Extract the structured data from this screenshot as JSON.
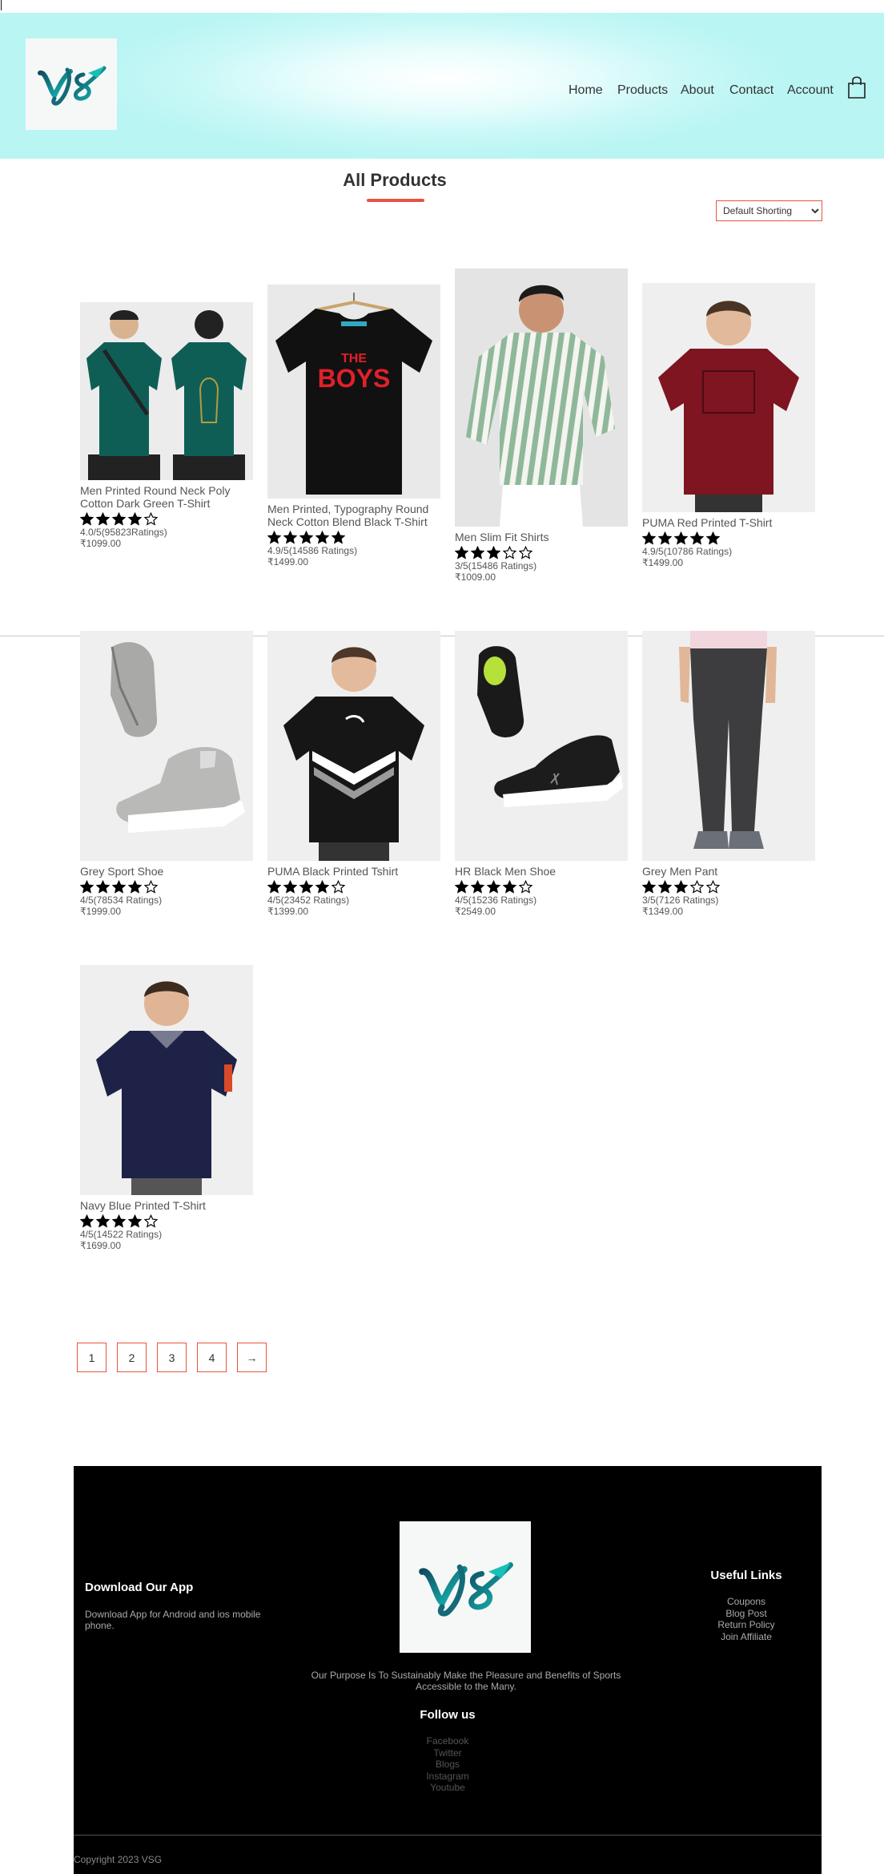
{
  "brand": {
    "logo_text": "VSG",
    "accent_color": "#e8543f",
    "header_color": "#b8f5f3"
  },
  "nav": {
    "items": [
      "Home",
      "Products",
      "About",
      "Contact",
      "Account"
    ],
    "cart_icon": "shopping-bag-icon"
  },
  "page": {
    "title": "All Products",
    "sort": {
      "selected": "Default Shorting"
    }
  },
  "products": [
    {
      "name": "Men Printed Round Neck Poly Cotton Dark Green T-Shirt",
      "stars": 4,
      "rating": "4.0/5(95823Ratings)",
      "price": "₹1099.00"
    },
    {
      "name": "Men Printed, Typography Round Neck Cotton Blend Black T-Shirt",
      "stars": 5,
      "rating": "4.9/5(14586 Ratings)",
      "price": "₹1499.00"
    },
    {
      "name": "Men Slim Fit Shirts",
      "stars": 3,
      "rating": "3/5(15486 Ratings)",
      "price": "₹1009.00"
    },
    {
      "name": "PUMA Red Printed T-Shirt",
      "stars": 5,
      "rating": "4.9/5(10786 Ratings)",
      "price": "₹1499.00"
    },
    {
      "name": "Grey Sport Shoe",
      "stars": 4,
      "rating": "4/5(78534 Ratings)",
      "price": "₹1999.00"
    },
    {
      "name": "PUMA Black Printed Tshirt",
      "stars": 4,
      "rating": "4/5(23452 Ratings)",
      "price": "₹1399.00"
    },
    {
      "name": "HR Black Men Shoe",
      "stars": 4,
      "rating": "4/5(15236 Ratings)",
      "price": "₹2549.00"
    },
    {
      "name": "Grey Men Pant",
      "stars": 3,
      "rating": "3/5(7126 Ratings)",
      "price": "₹1349.00"
    },
    {
      "name": "Navy Blue Printed T-Shirt",
      "stars": 4,
      "rating": "4/5(14522 Ratings)",
      "price": "₹1699.00"
    }
  ],
  "pagination": {
    "pages": [
      "1",
      "2",
      "3",
      "4"
    ],
    "next": "→"
  },
  "footer": {
    "download_title": "Download Our App",
    "download_text": "Download App for Android and ios mobile phone.",
    "purpose": "Our Purpose Is To Sustainably Make the Pleasure and Benefits of Sports Accessible to the Many.",
    "follow_title": "Follow us",
    "social": [
      "Facebook",
      "Twitter",
      "Blogs",
      "Instagram",
      "Youtube"
    ],
    "useful_title": "Useful Links",
    "useful": [
      "Coupons",
      "Blog Post",
      "Return Policy",
      "Join Affiliate"
    ],
    "copyright": "Copyright 2023 VSG"
  }
}
